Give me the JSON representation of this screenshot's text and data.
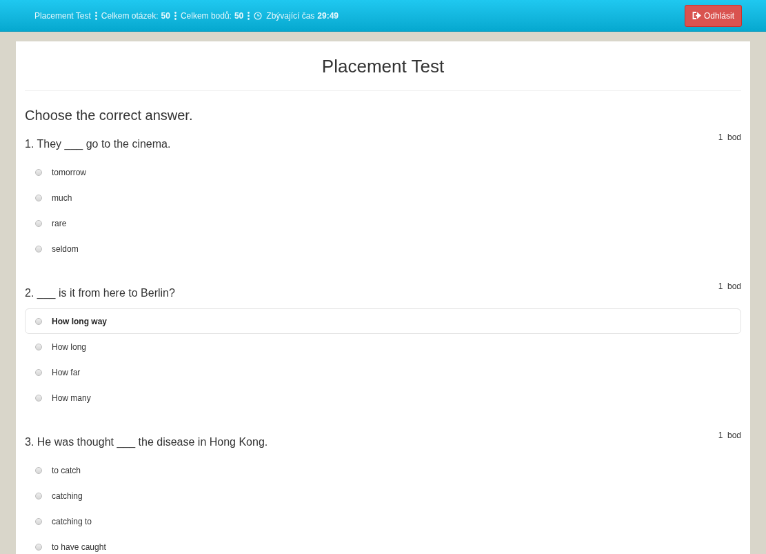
{
  "header": {
    "test_name": "Placement Test",
    "stats": [
      {
        "kind": "count",
        "label": "Celkem otázek:",
        "value": "50"
      },
      {
        "kind": "count",
        "label": "Celkem bodů:",
        "value": "50"
      },
      {
        "kind": "timer",
        "label": "Zbývající čas",
        "value": "29:49"
      }
    ],
    "logout_button": "Odhlásit"
  },
  "title": "Placement Test",
  "instruction": "Choose the correct answer.",
  "questions": [
    {
      "text": "1. They ___ go to the cinema.",
      "points": "1",
      "points_unit": "bod",
      "options": [
        {
          "label": "tomorrow",
          "checked": false,
          "highlighted": false
        },
        {
          "label": "much",
          "checked": false,
          "highlighted": false
        },
        {
          "label": "rare",
          "checked": false,
          "highlighted": false
        },
        {
          "label": "seldom",
          "checked": false,
          "highlighted": false
        }
      ]
    },
    {
      "text": "2. ___ is it from here to Berlin?",
      "points": "1",
      "points_unit": "bod",
      "options": [
        {
          "label": "How long way",
          "checked": false,
          "highlighted": true
        },
        {
          "label": "How long",
          "checked": false,
          "highlighted": false
        },
        {
          "label": "How far",
          "checked": false,
          "highlighted": false
        },
        {
          "label": "How many",
          "checked": false,
          "highlighted": false
        }
      ]
    },
    {
      "text": "3. He was thought ___ the disease in Hong Kong.",
      "points": "1",
      "points_unit": "bod",
      "options": [
        {
          "label": "to catch",
          "checked": false,
          "highlighted": false
        },
        {
          "label": "catching",
          "checked": false,
          "highlighted": false
        },
        {
          "label": "catching to",
          "checked": false,
          "highlighted": false
        },
        {
          "label": "to have caught",
          "checked": false,
          "highlighted": false
        }
      ]
    }
  ]
}
